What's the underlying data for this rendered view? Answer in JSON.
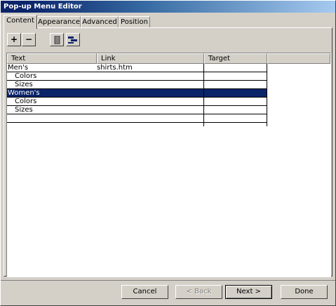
{
  "window": {
    "title": "Pop-up Menu Editor"
  },
  "tabs": [
    {
      "label": "Content"
    },
    {
      "label": "Appearance"
    },
    {
      "label": "Advanced"
    },
    {
      "label": "Position"
    }
  ],
  "toolbar": {
    "add_label": "+",
    "remove_label": "−",
    "icons": [
      "outdent-icon",
      "indent-icon"
    ]
  },
  "grid": {
    "columns": [
      "Text",
      "Link",
      "Target"
    ],
    "rows": [
      {
        "text": "Men's",
        "link": "shirts.htm",
        "target": "",
        "indent": false,
        "selected": false
      },
      {
        "text": "Colors",
        "link": "",
        "target": "",
        "indent": true,
        "selected": false
      },
      {
        "text": "Sizes",
        "link": "",
        "target": "",
        "indent": true,
        "selected": false
      },
      {
        "text": "Women's",
        "link": "",
        "target": "",
        "indent": false,
        "selected": true
      },
      {
        "text": "Colors",
        "link": "",
        "target": "",
        "indent": true,
        "selected": false
      },
      {
        "text": "Sizes",
        "link": "",
        "target": "",
        "indent": true,
        "selected": false
      },
      {
        "text": "",
        "link": "",
        "target": "",
        "indent": false,
        "selected": false
      }
    ]
  },
  "buttons": {
    "cancel": "Cancel",
    "back": "< Back",
    "next": "Next >",
    "done": "Done"
  },
  "colors": {
    "selection": "#0a246a",
    "face": "#d4d0c8"
  }
}
